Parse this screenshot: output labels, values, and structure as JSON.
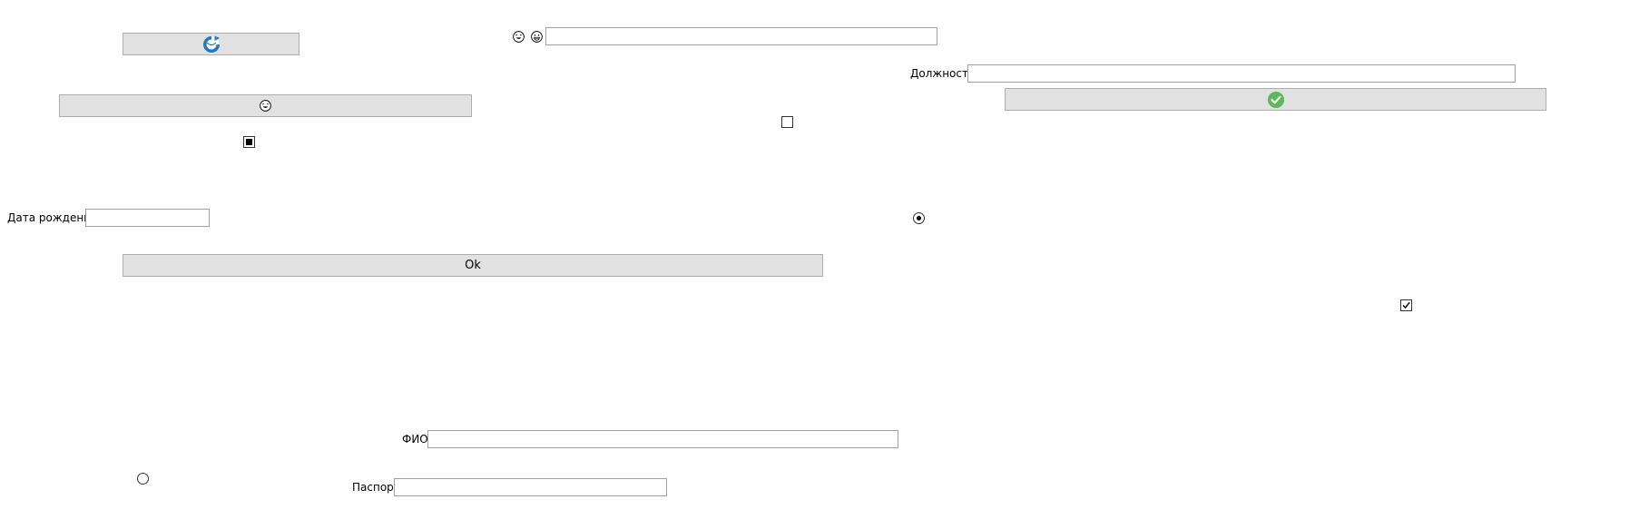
{
  "labels": {
    "position": "Должность",
    "birth_date": "Дата рождения",
    "full_name": "ФИО",
    "passport": "Паспорт"
  },
  "fields": {
    "top_search": "",
    "position": "",
    "birth_date": "",
    "full_name": "",
    "passport": ""
  },
  "buttons": {
    "ok_label": "Ok"
  },
  "icons": {
    "refresh_button": "refresh-icon",
    "emoji_button": "laughing-face-icon",
    "confirm_button": "green-checkmark-icon",
    "search_emoji_1": "laughing-face-icon",
    "search_emoji_2": "grinning-face-icon"
  },
  "states": {
    "checkbox_left": "indeterminate",
    "checkbox_middle": "unchecked",
    "checkbox_right": "checked",
    "radio_right": "selected",
    "radio_left": "unselected"
  },
  "colors": {
    "button_bg": "#e1e1e1",
    "button_border": "#adadad",
    "accent_blue": "#1e78c8",
    "accent_green": "#5cb85c"
  }
}
